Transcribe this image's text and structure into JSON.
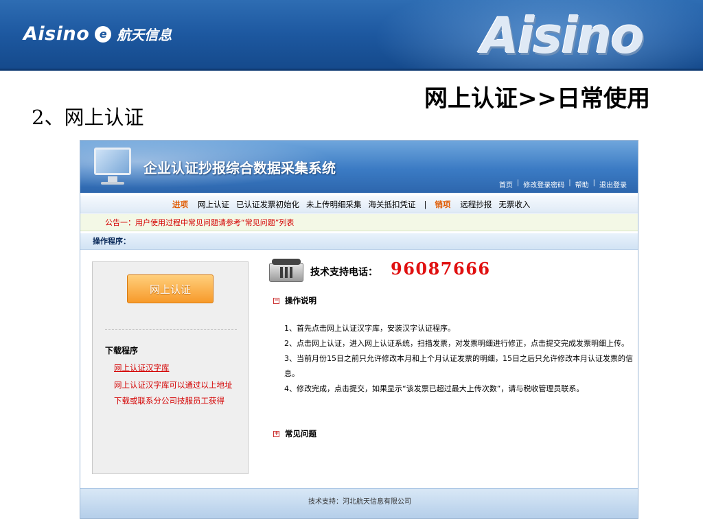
{
  "slide": {
    "logo_brand": "Aisino",
    "logo_mark": "e",
    "logo_cn": "航天信息",
    "big_logo": "Aisino",
    "title_right": "网上认证>>日常使用",
    "title_left": "2、网上认证"
  },
  "app": {
    "title": "企业认证抄报综合数据采集系统",
    "top_links": [
      "首页",
      "修改登录密码",
      "帮助",
      "退出登录"
    ],
    "top_sep": "|",
    "nav": {
      "cat_in": "进项",
      "in_items": [
        "网上认证",
        "已认证发票初始化",
        "未上传明细采集",
        "海关抵扣凭证"
      ],
      "bar": "|",
      "cat_out": "销项",
      "out_items": [
        "远程抄报",
        "无票收入"
      ]
    },
    "notice": "公告一：用户使用过程中常见问题请参考“常见问题”列表",
    "procedure_label": "操作程序：",
    "side": {
      "button": "网上认证",
      "download_title": "下载程序",
      "download_link": "网上认证汉字库",
      "download_note": "网上认证汉字库可以通过以上地址下载或联系分公司技服员工获得"
    },
    "support": {
      "label": "技术支持电话：",
      "number": "96087666"
    },
    "ops_title": "操作说明",
    "ops_toggle": "−",
    "steps": [
      "1、首先点击网上认证汉字库，安装汉字认证程序。",
      "2、点击网上认证，进入网上认证系统，扫描发票，对发票明细进行修正，点击提交完成发票明细上传。",
      "3、当前月份15日之前只允许修改本月和上个月认证发票的明细，15日之后只允许修改本月认证发票的信息。",
      "4、修改完成，点击提交，如果显示“该发票已超过最大上传次数”，请与税收管理员联系。"
    ],
    "faq_title": "常见问题",
    "faq_toggle": "+",
    "footer": "技术支持：河北航天信息有限公司"
  },
  "colors": {
    "banner_blue": "#1d58a0",
    "accent_orange": "#f79a2a",
    "alert_red": "#d40000",
    "nav_category": "#e05a00"
  }
}
